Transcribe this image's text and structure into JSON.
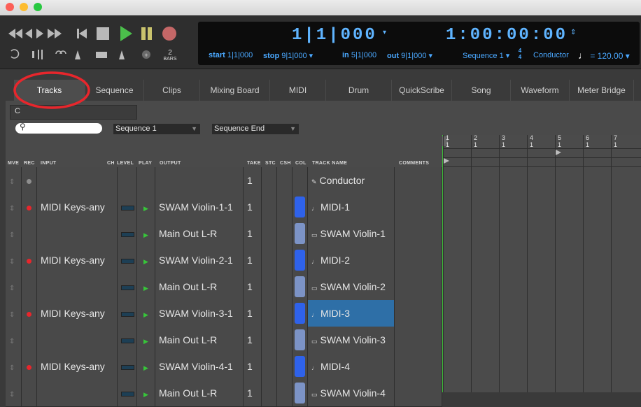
{
  "transport": {
    "bars_label": "BARS",
    "bars_value": "2"
  },
  "counter": {
    "main_position": "1|1|000",
    "secondary_position": "1:00:00:00",
    "start_label": "start",
    "start_value": "1|1|000",
    "stop_label": "stop",
    "stop_value": "9|1|000",
    "in_label": "in",
    "in_value": "5|1|000",
    "out_label": "out",
    "out_value": "9|1|000",
    "sequence": "Sequence 1",
    "meter_top": "4",
    "meter_bottom": "4",
    "conductor": "Conductor",
    "tempo": "= 120.00"
  },
  "tabs": [
    "Tracks",
    "Sequence",
    "Clips",
    "Mixing Board",
    "MIDI",
    "Drum",
    "QuickScribe",
    "Song",
    "Waveform",
    "Meter Bridge"
  ],
  "filter": {
    "c_label": "C",
    "search_placeholder": "",
    "sequence_select": "Sequence 1",
    "sequence_end_select": "Sequence End"
  },
  "columns": {
    "mve": "MVE",
    "rec": "REC",
    "input": "INPUT",
    "ch": "CH",
    "level": "LEVEL",
    "play": "PLAY",
    "output": "OUTPUT",
    "take": "TAKE",
    "stc": "STC",
    "csh": "CSH",
    "col": "COL",
    "track_name": "TRACK NAME",
    "comments": "COMMENTS"
  },
  "ruler": [
    {
      "bar": "1",
      "beat": "1"
    },
    {
      "bar": "2",
      "beat": "1"
    },
    {
      "bar": "3",
      "beat": "1"
    },
    {
      "bar": "4",
      "beat": "1"
    },
    {
      "bar": "5",
      "beat": "1"
    },
    {
      "bar": "6",
      "beat": "1"
    },
    {
      "bar": "7",
      "beat": "1"
    }
  ],
  "tracks": [
    {
      "kind": "conductor",
      "input": "",
      "output": "",
      "take": "1",
      "name": "Conductor",
      "rec": "gray",
      "color": "",
      "selected": false
    },
    {
      "kind": "midi",
      "input": "MIDI Keys-any",
      "output": "SWAM Violin-1-1",
      "take": "1",
      "name": "MIDI-1",
      "rec": "red",
      "color": "#2f62ea",
      "selected": false
    },
    {
      "kind": "audio",
      "input": "",
      "output": "Main Out L-R",
      "take": "1",
      "name": "SWAM Violin-1",
      "rec": "",
      "color": "#7c93c6",
      "selected": false
    },
    {
      "kind": "midi",
      "input": "MIDI Keys-any",
      "output": "SWAM Violin-2-1",
      "take": "1",
      "name": "MIDI-2",
      "rec": "red",
      "color": "#2f62ea",
      "selected": false
    },
    {
      "kind": "audio",
      "input": "",
      "output": "Main Out L-R",
      "take": "1",
      "name": "SWAM Violin-2",
      "rec": "",
      "color": "#7c93c6",
      "selected": false
    },
    {
      "kind": "midi",
      "input": "MIDI Keys-any",
      "output": "SWAM Violin-3-1",
      "take": "1",
      "name": "MIDI-3",
      "rec": "red",
      "color": "#2f62ea",
      "selected": true
    },
    {
      "kind": "audio",
      "input": "",
      "output": "Main Out L-R",
      "take": "1",
      "name": "SWAM Violin-3",
      "rec": "",
      "color": "#7c93c6",
      "selected": false
    },
    {
      "kind": "midi",
      "input": "MIDI Keys-any",
      "output": "SWAM Violin-4-1",
      "take": "1",
      "name": "MIDI-4",
      "rec": "red",
      "color": "#2f62ea",
      "selected": false
    },
    {
      "kind": "audio",
      "input": "",
      "output": "Main Out L-R",
      "take": "1",
      "name": "SWAM Violin-4",
      "rec": "",
      "color": "#7c93c6",
      "selected": false
    }
  ],
  "colors": {
    "counter_text": "#5fb4ff",
    "highlight_ring": "#e8262c",
    "selected_track": "#2e6fa7",
    "record_dot": "#e8262c",
    "play_arrow": "#37c53a",
    "playhead": "#3fbf3a"
  }
}
